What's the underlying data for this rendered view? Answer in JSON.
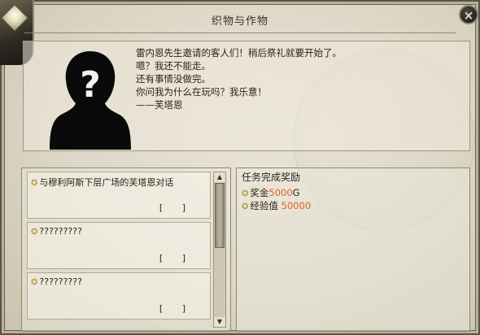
{
  "window": {
    "title": "织物与作物"
  },
  "dialog": {
    "lines": [
      "雷内恩先生邀请的客人们！稍后祭礼就要开始了。",
      "嗯？我还不能走。",
      "还有事情没做完。",
      "你问我为什么在玩吗？我乐意！",
      "——芙塔恩"
    ]
  },
  "quests": [
    {
      "label": "与穆利阿斯下层广场的芙塔恩对话",
      "status": "[   ]"
    },
    {
      "label": "?????????",
      "status": "[   ]"
    },
    {
      "label": "?????????",
      "status": "[   ]"
    }
  ],
  "rewards": {
    "title": "任务完成奖励",
    "gold_label": "奖金",
    "gold_value": "5000",
    "gold_unit": "G",
    "exp_label": "经验值",
    "exp_value": "50000"
  },
  "close_label": "×",
  "colors": {
    "accent": "#e0622a",
    "star": "#b69a3a"
  }
}
